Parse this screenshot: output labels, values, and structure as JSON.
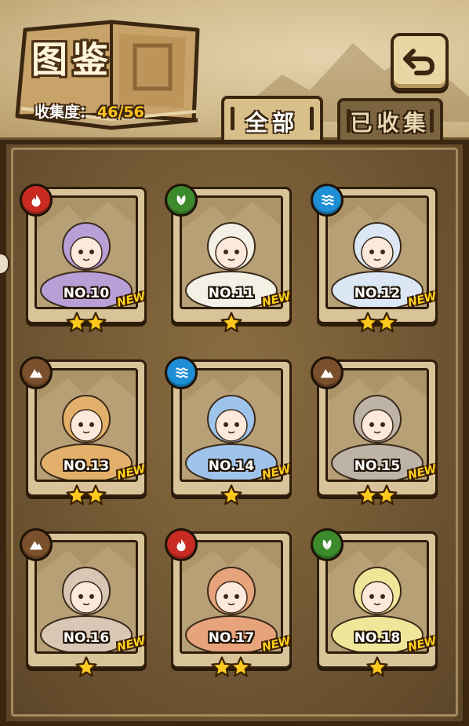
{
  "header": {
    "title": "图鉴",
    "progress_label": "收集度：",
    "progress_value": "46/56"
  },
  "tabs": [
    {
      "label": "全部",
      "active": true
    },
    {
      "label": "已收集",
      "active": false
    }
  ],
  "badge_text": "NEW",
  "colors": {
    "fire": "#c92b23",
    "grass": "#3c8a2b",
    "water": "#1e8ed6",
    "earth": "#7a4f2c",
    "star": "#ffc81e"
  },
  "cards": [
    {
      "number": "NO.10",
      "element": "fire",
      "stars": 2,
      "is_new": true
    },
    {
      "number": "NO.11",
      "element": "grass",
      "stars": 1,
      "is_new": true
    },
    {
      "number": "NO.12",
      "element": "water",
      "stars": 2,
      "is_new": true
    },
    {
      "number": "NO.13",
      "element": "earth",
      "stars": 2,
      "is_new": true
    },
    {
      "number": "NO.14",
      "element": "water",
      "stars": 1,
      "is_new": true
    },
    {
      "number": "NO.15",
      "element": "earth",
      "stars": 2,
      "is_new": true
    },
    {
      "number": "NO.16",
      "element": "earth",
      "stars": 1,
      "is_new": true
    },
    {
      "number": "NO.17",
      "element": "fire",
      "stars": 2,
      "is_new": true
    },
    {
      "number": "NO.18",
      "element": "grass",
      "stars": 1,
      "is_new": true
    }
  ]
}
